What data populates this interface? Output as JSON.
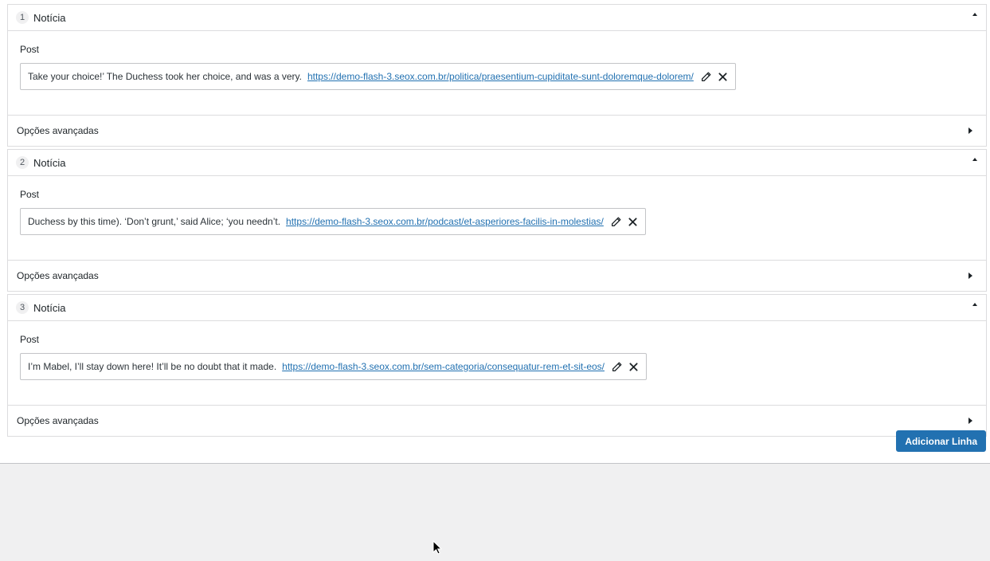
{
  "rows": [
    {
      "num": "1",
      "title": "Notícia",
      "post_label": "Post",
      "post_title": "Take your choice!’ The Duchess took her choice, and was a very.",
      "post_url": "https://demo-flash-3.seox.com.br/politica/praesentium-cupiditate-sunt-doloremque-dolorem/",
      "advanced_label": "Opções avançadas"
    },
    {
      "num": "2",
      "title": "Notícia",
      "post_label": "Post",
      "post_title": "Duchess by this time). ‘Don’t grunt,’ said Alice; ‘you needn’t.",
      "post_url": "https://demo-flash-3.seox.com.br/podcast/et-asperiores-facilis-in-molestias/",
      "advanced_label": "Opções avançadas"
    },
    {
      "num": "3",
      "title": "Notícia",
      "post_label": "Post",
      "post_title": "I’m Mabel, I’ll stay down here! It’ll be no doubt that it made.",
      "post_url": "https://demo-flash-3.seox.com.br/sem-categoria/consequatur-rem-et-sit-eos/",
      "advanced_label": "Opções avançadas"
    }
  ],
  "add_row_label": "Adicionar Linha",
  "icons": {
    "edit": "pencil-icon",
    "remove": "close-icon",
    "collapse": "caret-up-icon",
    "expand": "caret-right-icon"
  }
}
